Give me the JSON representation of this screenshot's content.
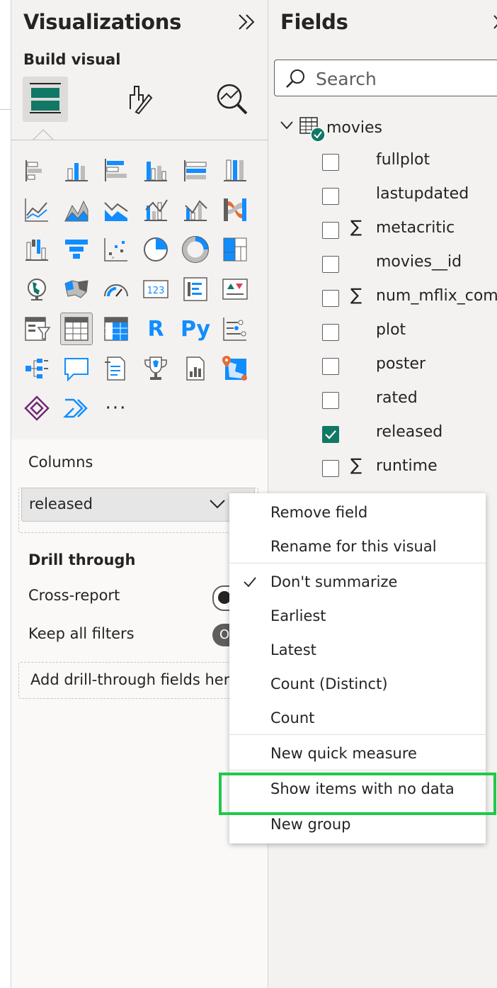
{
  "visualizations": {
    "title": "Visualizations",
    "build_label": "Build visual",
    "gallery_text_icons": {
      "r": "R",
      "py": "Py",
      "more": "···",
      "card": "123"
    },
    "wells": {
      "columns_label": "Columns",
      "column_field": "released",
      "drill_through_label": "Drill through",
      "cross_report_label": "Cross-report",
      "keep_all_filters_label": "Keep all filters",
      "keep_all_filters_toggle_text": "O",
      "drop_zone_text": "Add drill-through fields here"
    }
  },
  "fields": {
    "title": "Fields",
    "search_placeholder": "Search",
    "table_name": "movies",
    "items": [
      {
        "name": "fullplot",
        "checked": false,
        "sigma": false
      },
      {
        "name": "lastupdated",
        "checked": false,
        "sigma": false
      },
      {
        "name": "metacritic",
        "checked": false,
        "sigma": true
      },
      {
        "name": "movies__id",
        "checked": false,
        "sigma": false
      },
      {
        "name": "num_mflix_com...",
        "checked": false,
        "sigma": true
      },
      {
        "name": "plot",
        "checked": false,
        "sigma": false
      },
      {
        "name": "poster",
        "checked": false,
        "sigma": false
      },
      {
        "name": "rated",
        "checked": false,
        "sigma": false
      },
      {
        "name": "released",
        "checked": true,
        "sigma": false
      },
      {
        "name": "runtime",
        "checked": false,
        "sigma": true
      }
    ],
    "sigma_symbol": "∑"
  },
  "context_menu": {
    "items": [
      {
        "label": "Remove field"
      },
      {
        "label": "Rename for this visual"
      },
      {
        "label": "Don't summarize",
        "checked": true
      },
      {
        "label": "Earliest"
      },
      {
        "label": "Latest"
      },
      {
        "label": "Count (Distinct)"
      },
      {
        "label": "Count"
      },
      {
        "label": "New quick measure"
      },
      {
        "label": "Show items with no data",
        "highlighted": true
      },
      {
        "label": "New group"
      }
    ]
  },
  "colors": {
    "accent_teal": "#117865",
    "highlight_green": "#1fc94a",
    "chart_blue": "#118dff",
    "chart_dark": "#605e5c"
  }
}
